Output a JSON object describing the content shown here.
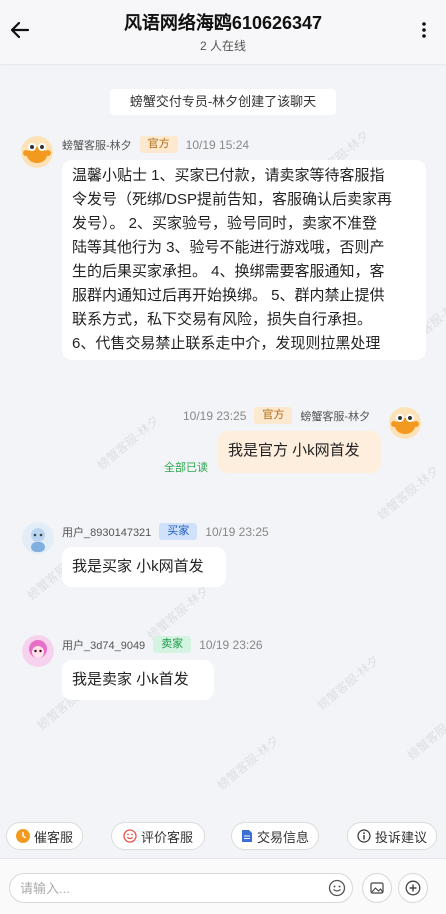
{
  "header": {
    "title": "风语网络海鸥610626347",
    "online": "2 人在线",
    "back_icon": "arrow-left-icon",
    "more_icon": "more-vertical-icon"
  },
  "watermark_text": "螃蟹客服-林夕",
  "system_note": "螃蟹交付专员-林夕创建了该聊天",
  "messages": [
    {
      "sender": "螃蟹客服-林夕",
      "badge": "官方",
      "time": "10/19 15:24",
      "lines": [
        "温馨小贴士 1、买家已付款，请卖家等待客服指",
        "令发号（死绑/DSP提前告知，客服确认后卖家再",
        "发号）。 2、买家验号，验号同时，卖家不准登",
        "陆等其他行为 3、验号不能进行游戏哦，否则产",
        "生的后果买家承担。 4、换绑需要客服通知，客",
        "服群内通知过后再开始换绑。 5、群内禁止提供",
        "联系方式，私下交易有风险，损失自行承担。",
        "6、代售交易禁止联系走中介，发现则拉黑处理"
      ]
    },
    {
      "sender": "螃蟹客服-林夕",
      "badge": "官方",
      "time": "10/19 23:25",
      "text": "我是官方 小k网首发",
      "status": "全部已读"
    },
    {
      "sender": "用户_8930147321",
      "badge": "买家",
      "time": "10/19 23:25",
      "text": "我是买家 小k网首发"
    },
    {
      "sender": "用户_3d74_9049",
      "badge": "卖家",
      "time": "10/19 23:26",
      "text": "我是卖家 小k首发"
    }
  ],
  "quick_actions": [
    {
      "label": "催客服",
      "icon": "clock-icon"
    },
    {
      "label": "评价客服",
      "icon": "smile-icon"
    },
    {
      "label": "交易信息",
      "icon": "document-icon"
    },
    {
      "label": "投诉建议",
      "icon": "info-icon"
    }
  ],
  "input": {
    "placeholder": "请输入...",
    "value": ""
  },
  "colors": {
    "official_badge_bg": "#fde9cf",
    "buyer_badge_bg": "#cfe1fb",
    "seller_badge_bg": "#d4f3e0",
    "self_bubble": "#fdeedd",
    "read_status": "#2aa84a"
  }
}
